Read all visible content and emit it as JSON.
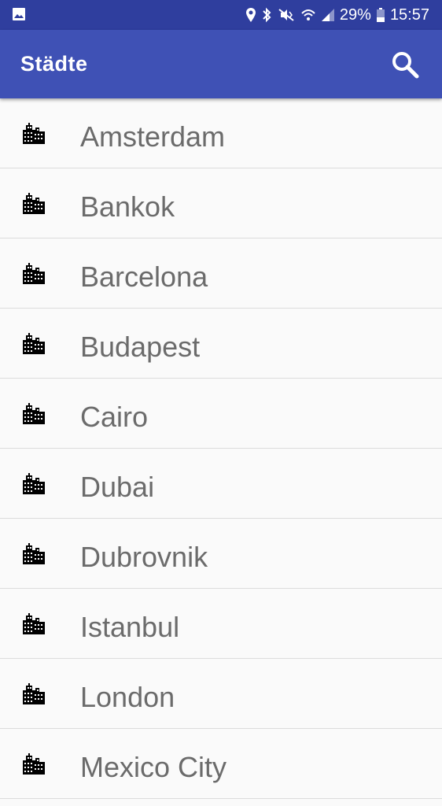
{
  "status_bar": {
    "battery_percent": "29%",
    "time": "15:57"
  },
  "app_bar": {
    "title": "Städte",
    "search_icon": "search-icon"
  },
  "list_icon": "city-icon",
  "cities": [
    {
      "name": "Amsterdam"
    },
    {
      "name": "Bankok"
    },
    {
      "name": "Barcelona"
    },
    {
      "name": "Budapest"
    },
    {
      "name": "Cairo"
    },
    {
      "name": "Dubai"
    },
    {
      "name": "Dubrovnik"
    },
    {
      "name": "Istanbul"
    },
    {
      "name": "London"
    },
    {
      "name": "Mexico City"
    }
  ],
  "colors": {
    "status_bar": "#2f3e9e",
    "app_bar": "#3f51b5",
    "text": "#6b6b6b"
  }
}
